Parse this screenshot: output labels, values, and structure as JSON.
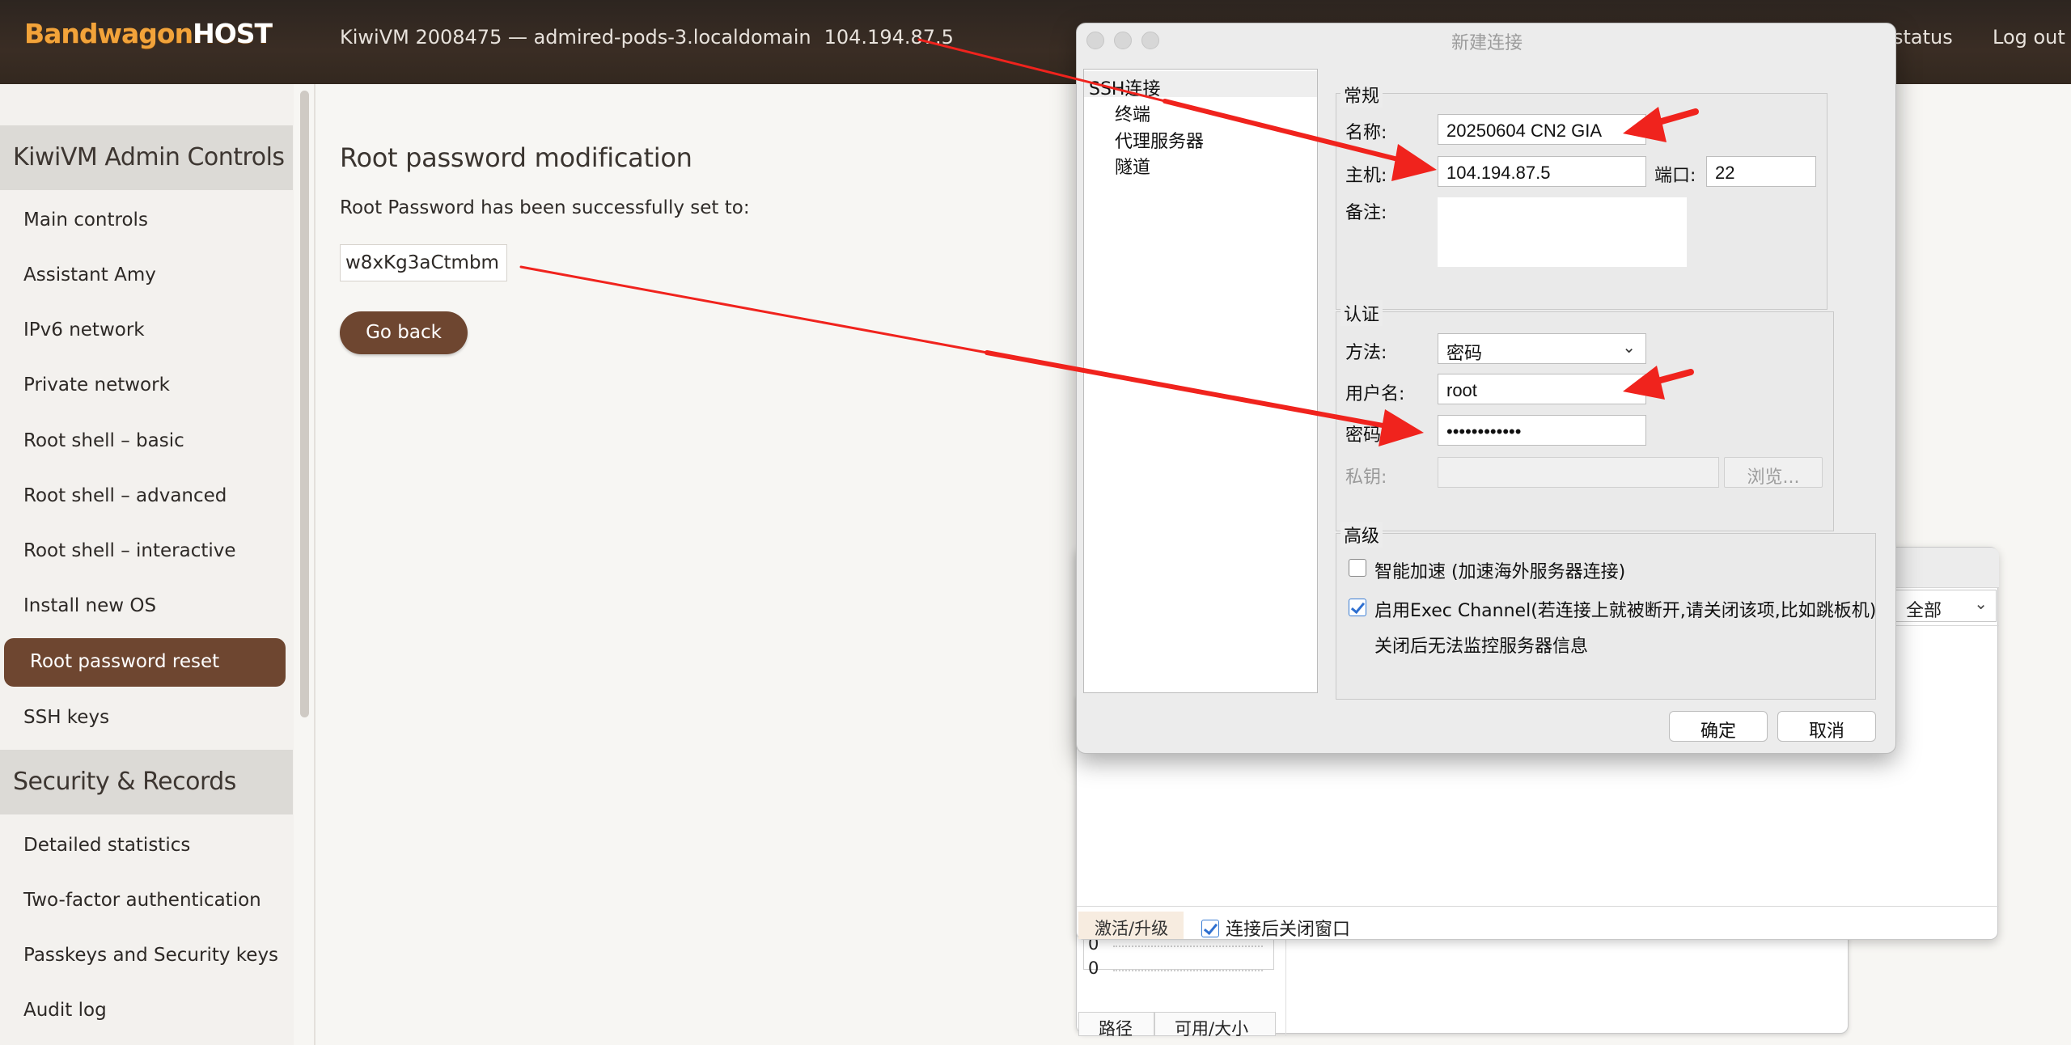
{
  "app": {
    "logo_main": "Bandwagon",
    "logo_accent": "HOST",
    "vm_info": "KiwiVM 2008475 — admired-pods-3.localdomain",
    "vm_ip": "104.194.87.5",
    "status_link": "status",
    "logout_link": "Log out"
  },
  "sidebar": {
    "section1": "KiwiVM Admin Controls",
    "items1": [
      "Main controls",
      "Assistant Amy",
      "IPv6 network",
      "Private network",
      "Root shell – basic",
      "Root shell – advanced",
      "Root shell – interactive",
      "Install new OS",
      "Root password reset",
      "SSH keys"
    ],
    "active_item": "Root password reset",
    "section2": "Security & Records",
    "items2": [
      "Detailed statistics",
      "Two-factor authentication",
      "Passkeys and Security keys",
      "Audit log"
    ]
  },
  "main": {
    "title": "Root password modification",
    "message": "Root Password has been successfully set to:",
    "password": "w8xKg3aCtmbm",
    "go_back": "Go back"
  },
  "dialog": {
    "title": "新建连接",
    "tree": [
      "SSH连接",
      "终端",
      "代理服务器",
      "隧道"
    ],
    "general_group": "常规",
    "name_label": "名称:",
    "name_value": "20250604 CN2 GIA",
    "host_label": "主机:",
    "host_value": "104.194.87.5",
    "port_label": "端口:",
    "port_value": "22",
    "note_label": "备注:",
    "auth_group": "认证",
    "method_label": "方法:",
    "method_value": "密码",
    "user_label": "用户名:",
    "user_value": "root",
    "pass_label": "密码:",
    "pass_value": "••••••••••••",
    "key_label": "私钥:",
    "browse_button": "浏览...",
    "advanced_group": "高级",
    "accel_label": "智能加速 (加速海外服务器连接)",
    "exec_label": "启用Exec Channel(若连接上就被断开,请关闭该项,比如跳板机)",
    "exec_note": "关闭后无法监控服务器信息",
    "ok_button": "确定",
    "cancel_button": "取消"
  },
  "bg_window": {
    "filter_value": "全部",
    "activate_button": "激活/升级",
    "close_after_label": "连接后关闭窗口",
    "zero1": "0",
    "zero2": "0",
    "col_path": "路径",
    "col_avail": "可用/大小"
  },
  "colors": {
    "brand_brown": "#6e4630",
    "logo_orange": "#f2a33a",
    "annotation_red": "#f0231d"
  }
}
